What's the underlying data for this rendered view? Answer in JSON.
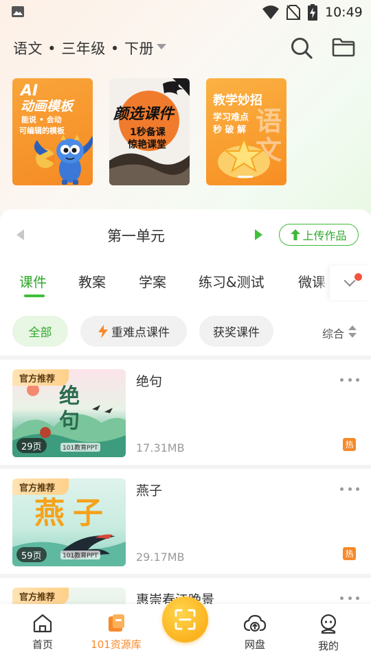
{
  "status_bar": {
    "time": "10:49",
    "icons": [
      "gallery-icon",
      "wifi-icon",
      "no-sim-icon",
      "battery-charging-icon"
    ]
  },
  "header": {
    "subject": "语文 • 三年级 • 下册",
    "icons": [
      "search-icon",
      "folder-icon"
    ]
  },
  "banners": [
    {
      "line1": "AI",
      "line2": "动画模板",
      "line3": "能说 • 会动",
      "line4": "可编辑的模板"
    },
    {
      "line1": "颜选课件",
      "line2": "1秒备课",
      "line3": "惊艳课堂"
    },
    {
      "line1": "教学妙招",
      "line2": "学习难点",
      "line3": "秒 破 解",
      "deco": "语文"
    }
  ],
  "unit": {
    "title": "第一单元",
    "upload_label": "上传作品"
  },
  "tabs": [
    "课件",
    "教案",
    "学案",
    "练习&测试",
    "微课"
  ],
  "filters": {
    "chips": [
      "全部",
      "重难点课件",
      "获奖课件"
    ],
    "sort_label": "综合"
  },
  "items": [
    {
      "tag": "官方推荐",
      "title": "绝句",
      "thumb_text": "绝句",
      "pages": "29页",
      "size": "17.31MB",
      "badge": "热",
      "brand": "101教育PPT"
    },
    {
      "tag": "官方推荐",
      "title": "燕子",
      "thumb_text": "燕子",
      "pages": "59页",
      "size": "29.17MB",
      "badge": "热",
      "brand": "101教育PPT"
    },
    {
      "tag": "官方推荐",
      "title": "惠崇春江晚景"
    }
  ],
  "bottom_nav": {
    "items": [
      "首页",
      "101资源库",
      "网盘",
      "我的"
    ],
    "active": "101资源库"
  },
  "colors": {
    "accent_green": "#3fbf3a",
    "accent_orange": "#f7892b",
    "scan_yellow": "#fbb31f"
  }
}
